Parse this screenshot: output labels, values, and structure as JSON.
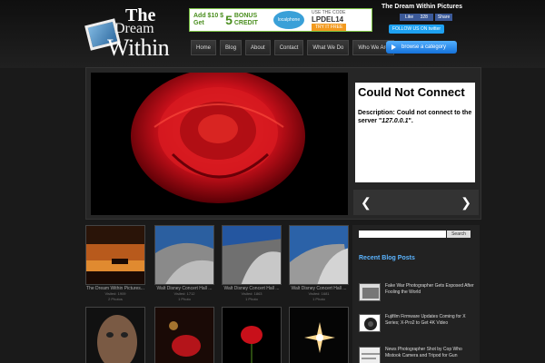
{
  "site": {
    "logo_line1": "The",
    "logo_line2": "Dream",
    "logo_line3": "Within",
    "title": "The Dream Within Pictures"
  },
  "ad": {
    "add_text": "Add $10 $",
    "big": "5",
    "bonus": "BONUS",
    "get": "Get",
    "credit": "CREDIT",
    "brand": "localphone",
    "use_code": "USE THE CODE",
    "code": "LPDEL14",
    "cta": "TRY IT FREE"
  },
  "social": {
    "fb_like": "Like",
    "fb_count": "328",
    "fb_share": "Share",
    "twitter": "FOLLOW US ON twitter"
  },
  "nav": [
    {
      "label": "Home"
    },
    {
      "label": "Blog"
    },
    {
      "label": "About"
    },
    {
      "label": "Contact"
    },
    {
      "label": "What We Do"
    },
    {
      "label": "Who We Are"
    }
  ],
  "browse_label": "browse a category",
  "error": {
    "title": "Could Not Connect",
    "desc_prefix": "Description: Could not connect to the server \"",
    "desc_server": "127.0.0.1",
    "desc_suffix": "\"."
  },
  "gallery": [
    {
      "title": "The Dream Within Pictures...",
      "views": "Visited: 1909",
      "photos": "2 Photos"
    },
    {
      "title": "Walt Disney Concert Hall ...",
      "views": "Visited: 1712",
      "photos": "1 Photo"
    },
    {
      "title": "Walt Disney Concert Hall ...",
      "views": "Visited: 1863",
      "photos": "1 Photo"
    },
    {
      "title": "Walt Disney Concert Hall ...",
      "views": "Visited: 1681",
      "photos": "1 Photo"
    }
  ],
  "search": {
    "button": "Search"
  },
  "recent": {
    "title": "Recent Blog Posts",
    "posts": [
      {
        "title": "Fake War Photographer Gets Exposed After Fooling the World"
      },
      {
        "title": "Fujifilm Firmware Updates Coming for X Series; X-Pro2 to Get 4K Video"
      },
      {
        "title": "News Photographer Shot by Cop Who Mistook Camera and Tripod for Gun"
      }
    ]
  },
  "colors": {
    "accent_blue": "#5bb4ff",
    "rose_red": "#c8101a"
  }
}
